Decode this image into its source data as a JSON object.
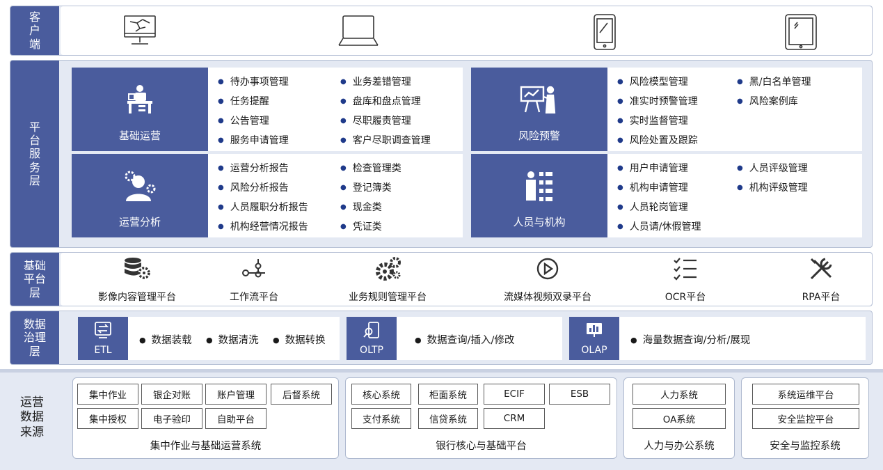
{
  "client_layer": {
    "label": [
      "客",
      "户",
      "端"
    ],
    "devices": [
      "monitor-icon",
      "laptop-icon",
      "phone-icon",
      "tablet-icon"
    ]
  },
  "platform_service_layer": {
    "label": [
      "平",
      "台",
      "服",
      "务",
      "层"
    ],
    "cards": [
      {
        "name": "基础运营",
        "icon": "office-worker-icon",
        "items": [
          "待办事项管理",
          "任务提醒",
          "公告管理",
          "服务申请管理",
          "业务差错管理",
          "盘库和盘点管理",
          "尽职履责管理",
          "客户尽职调查管理"
        ]
      },
      {
        "name": "风险预警",
        "icon": "presentation-icon",
        "items": [
          "风险模型管理",
          "准实时预警管理",
          "实时监督管理",
          "风险处置及跟踪",
          "黑/白名单管理",
          "风险案例库"
        ]
      },
      {
        "name": "运营分析",
        "icon": "user-gear-icon",
        "items": [
          "运营分析报告",
          "风险分析报告",
          "人员履职分析报告",
          "机构经营情况报告",
          "检查管理类",
          "登记簿类",
          "现金类",
          "凭证类"
        ]
      },
      {
        "name": "人员与机构",
        "icon": "people-org-icon",
        "items": [
          "用户申请管理",
          "机构申请管理",
          "人员轮岗管理",
          "人员请/休假管理",
          "人员评级管理",
          "机构评级管理"
        ]
      }
    ]
  },
  "basic_platform_layer": {
    "label": [
      "基础",
      "平台",
      "层"
    ],
    "platforms": [
      {
        "name": "影像内容管理平台",
        "icon": "database-gear-icon"
      },
      {
        "name": "工作流平台",
        "icon": "workflow-icon"
      },
      {
        "name": "业务规则管理平台",
        "icon": "gears-icon"
      },
      {
        "name": "流媒体视频双录平台",
        "icon": "play-icon"
      },
      {
        "name": "OCR平台",
        "icon": "checklist-icon"
      },
      {
        "name": "RPA平台",
        "icon": "tools-icon"
      }
    ]
  },
  "data_governance_layer": {
    "label": [
      "数据",
      "治理",
      "层"
    ],
    "blocks": [
      {
        "name": "ETL",
        "icon": "transfer-icon",
        "items": [
          "数据装载",
          "数据清洗",
          "数据转换"
        ]
      },
      {
        "name": "OLTP",
        "icon": "phone-search-icon",
        "items": [
          "数据查询/插入/修改"
        ]
      },
      {
        "name": "OLAP",
        "icon": "bar-board-icon",
        "items": [
          "海量数据查询/分析/展现"
        ]
      }
    ]
  },
  "data_source": {
    "label": [
      "运营",
      "数据",
      "来源"
    ],
    "groups": [
      {
        "name": "集中作业与基础运营系统",
        "systems": [
          "集中作业",
          "银企对账",
          "账户管理",
          "后督系统",
          "集中授权",
          "电子验印",
          "自助平台"
        ]
      },
      {
        "name": "银行核心与基础平台",
        "systems": [
          "核心系统",
          "柜面系统",
          "ECIF",
          "ESB",
          "支付系统",
          "信贷系统",
          "CRM"
        ]
      },
      {
        "name": "人力与办公系统",
        "systems": [
          "人力系统",
          "OA系统"
        ]
      },
      {
        "name": "安全与监控系统",
        "systems": [
          "系统运维平台",
          "安全监控平台"
        ]
      }
    ]
  },
  "colors": {
    "primary": "#4a5c9d",
    "band": "#e4e9f3",
    "bullet": "#1f3a8a"
  }
}
